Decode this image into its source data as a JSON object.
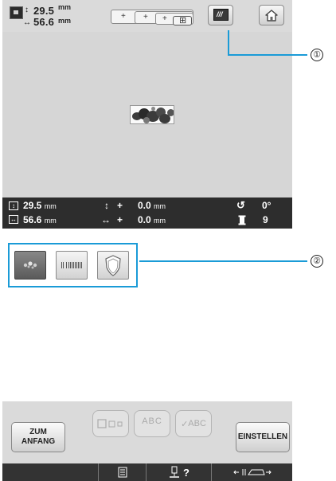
{
  "top": {
    "height": "29.5",
    "width": "56.6",
    "unit": "mm"
  },
  "info": {
    "height": "29.5",
    "width": "56.6",
    "unit": "mm",
    "move_v_sign": "+",
    "move_v": "0.0",
    "move_h_sign": "+",
    "move_h": "0.0",
    "angle": "0°",
    "colors": "9"
  },
  "callouts": {
    "one": "①",
    "two": "②"
  },
  "buttons": {
    "home_icon": "home-icon",
    "view_icon": "embroidery-view-icon",
    "start_line1": "ZUM",
    "start_line2": "ANFANG",
    "settings": "EINSTELLEN",
    "ghost_abc_arc": "ABC",
    "ghost_abc_check": "ABC"
  },
  "bottombar": {
    "help": "?"
  },
  "colors": {
    "accent": "#1a9bd7",
    "infobar": "#2d2d2d",
    "screen_bg": "#d6d6d6"
  }
}
